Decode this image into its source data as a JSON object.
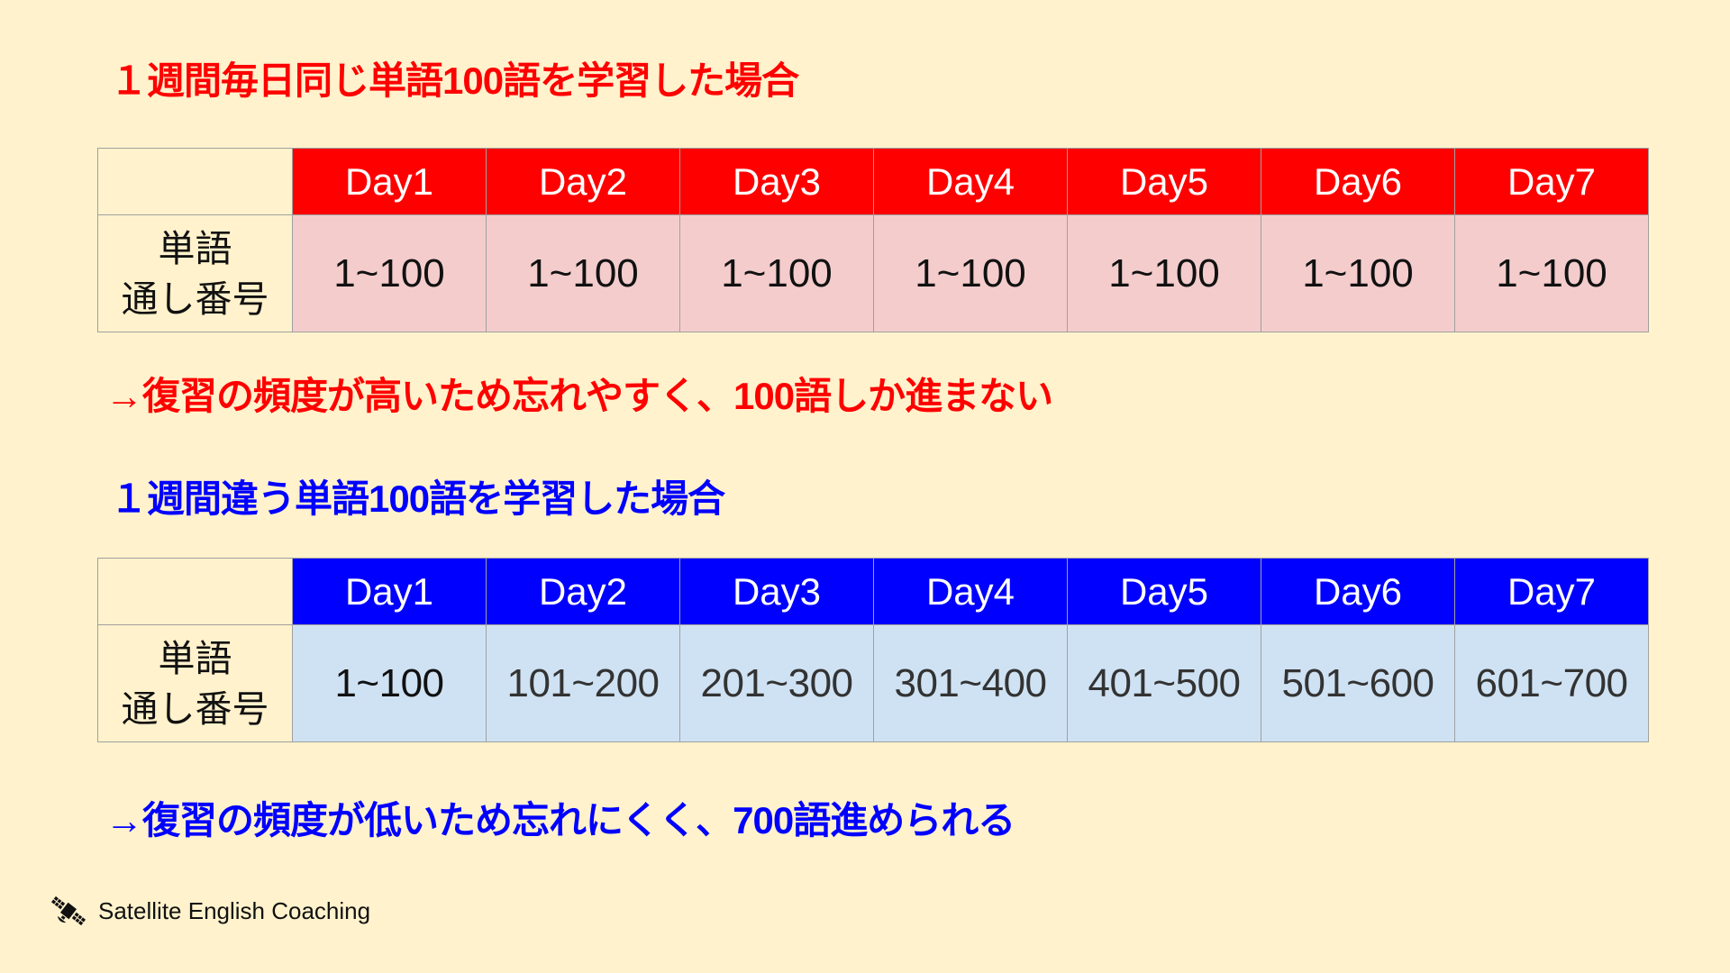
{
  "section_same": {
    "title": "１週間毎日同じ単語100語を学習した場合",
    "row_label_line1": "単語",
    "row_label_line2": "通し番号",
    "days": [
      "Day1",
      "Day2",
      "Day3",
      "Day4",
      "Day5",
      "Day6",
      "Day7"
    ],
    "ranges": [
      "1~100",
      "1~100",
      "1~100",
      "1~100",
      "1~100",
      "1~100",
      "1~100"
    ],
    "conclusion": "→復習の頻度が高いため忘れやすく、100語しか進まない",
    "accent_color": "#FF0000",
    "cell_color": "#F4CCCC"
  },
  "section_different": {
    "title": "１週間違う単語100語を学習した場合",
    "row_label_line1": "単語",
    "row_label_line2": "通し番号",
    "days": [
      "Day1",
      "Day2",
      "Day3",
      "Day4",
      "Day5",
      "Day6",
      "Day7"
    ],
    "ranges": [
      "1~100",
      "101~200",
      "201~300",
      "301~400",
      "401~500",
      "501~600",
      "601~700"
    ],
    "conclusion": "→復習の頻度が低いため忘れにくく、700語進められる",
    "accent_color": "#0000FF",
    "cell_color": "#CFE2F3"
  },
  "footer": {
    "icon": "satellite-icon",
    "brand": "Satellite English Coaching"
  },
  "background_color": "#FFF2CC"
}
